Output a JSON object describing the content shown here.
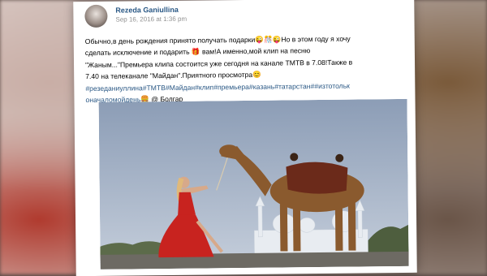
{
  "post": {
    "author": "Rezeda Ganiullina",
    "date": "Sep 16, 2016 at 1:36 pm",
    "text_lines": [
      "Обычно,в день рождения принято получать подарки😜🎊😜Но в этом году я хочу",
      "сделать исключение и подарить 🎁 вам!А именно,мой клип на песню",
      "\"Жаным...\"Премьера клипа состоится уже сегодня на канале ТМТВ в 7.08!Также в",
      "7.40 на телеканале \"Майдан\".Приятного просмотра😊"
    ],
    "hashtag_lines": [
      "#резеданиуллина#ТМТВ#Майдан#клип#премьера#казань#татарстан##изтотольк",
      "оначаломойдень🍔"
    ],
    "location": "@ Болгар"
  },
  "colors": {
    "link": "#2a5885",
    "meta": "#939393",
    "sky": "#9fb0c6",
    "dress": "#c8231f",
    "camel": "#8a5a2e"
  },
  "icons": {
    "avatar": "profile-photo",
    "photo": "woman-with-camel-photo"
  }
}
